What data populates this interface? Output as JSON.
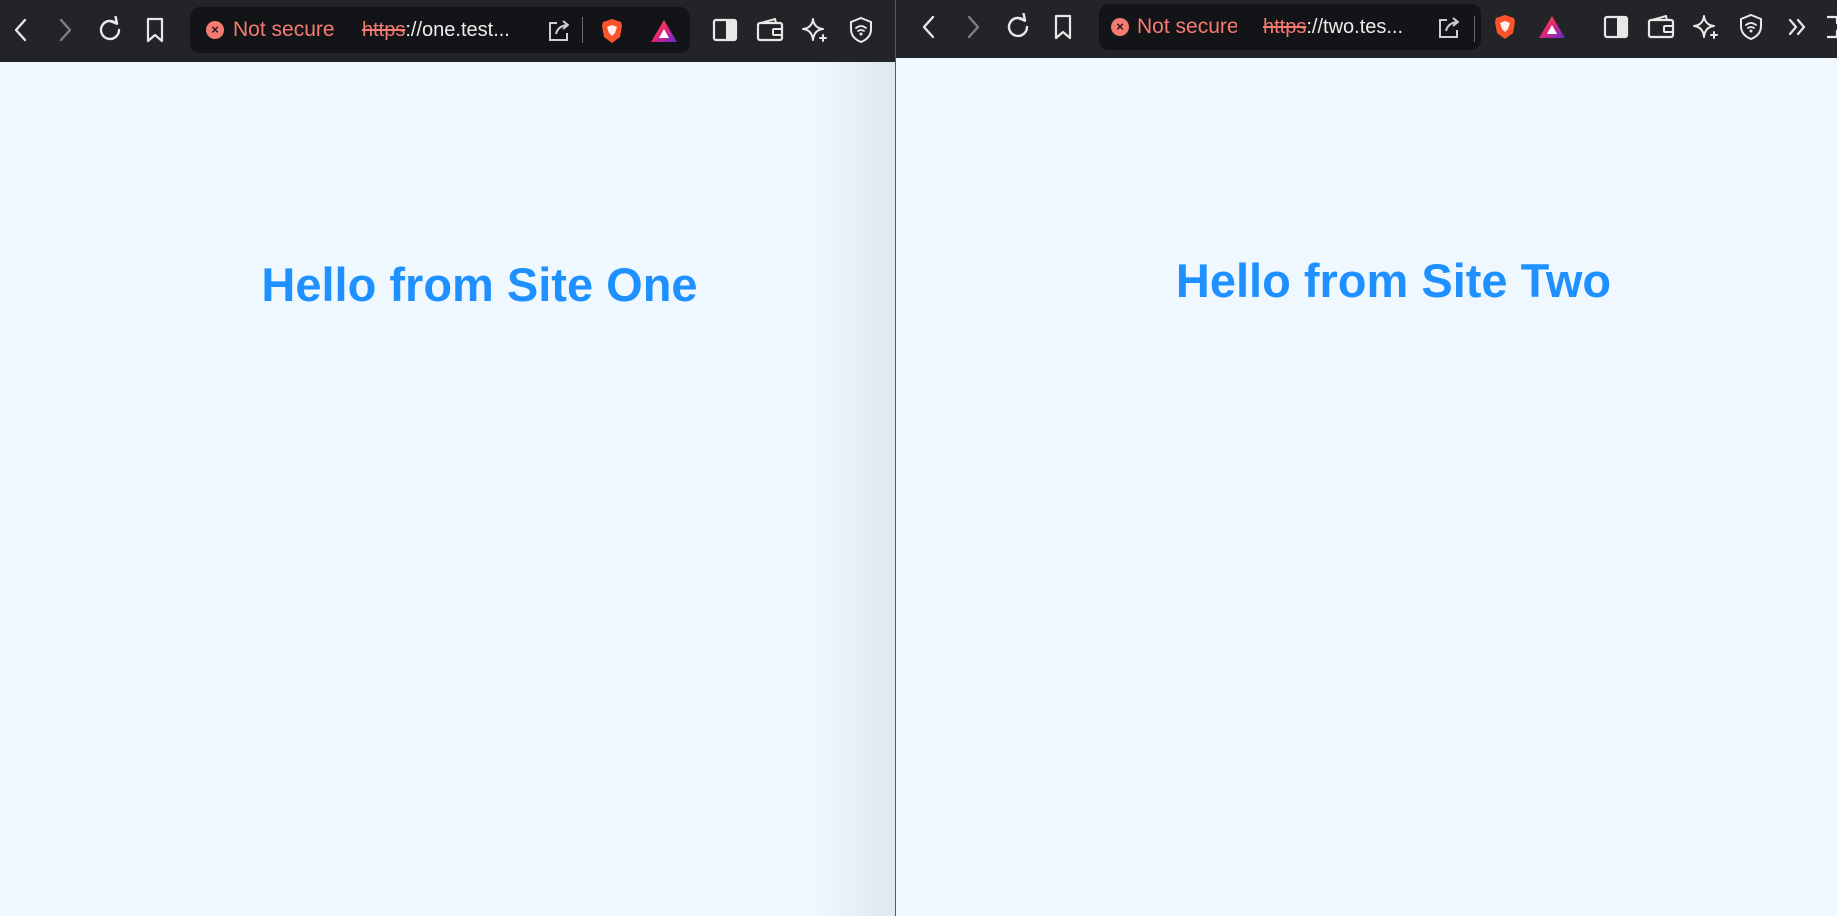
{
  "left_window": {
    "security_label": "Not secure",
    "url_scheme": "https",
    "url_rest": "://one.test...",
    "heading": "Hello from Site One"
  },
  "right_window": {
    "security_label": "Not secure",
    "url_scheme": "https",
    "url_rest": "://two.tes...",
    "heading": "Hello from Site Two"
  },
  "colors": {
    "toolbar": "#232428",
    "omnibox": "#131417",
    "warning": "#f47a72",
    "page_background": "#f0f8ff",
    "heading": "#1e90ff"
  },
  "icons": [
    "back-icon",
    "forward-icon",
    "reload-icon",
    "bookmark-icon",
    "not-secure-icon",
    "share-icon",
    "brave-shields-icon",
    "brave-rewards-icon",
    "sidebar-icon",
    "wallet-icon",
    "leo-ai-icon",
    "vpn-icon",
    "overflow-icon"
  ]
}
